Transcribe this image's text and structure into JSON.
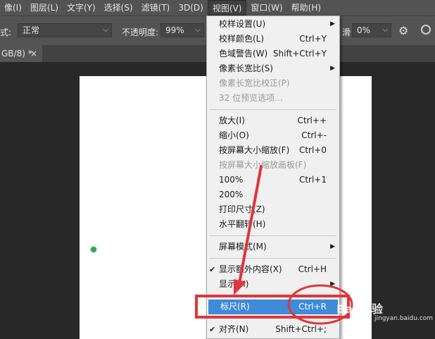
{
  "menubar": {
    "items": [
      "像(I)",
      "图层(L)",
      "文字(Y)",
      "选择(S)",
      "滤镜(T)",
      "3D(D)",
      "视图(V)",
      "窗口(W)",
      "帮助(H)"
    ],
    "active_index": 6
  },
  "options": {
    "mode_label": "式:",
    "mode_value": "正常",
    "opacity_label": "不透明度:",
    "opacity_value": "99%",
    "right_label": "滑",
    "right_value": "0%"
  },
  "tab": {
    "title": "GB/8) *",
    "close": "×"
  },
  "view_menu": {
    "items": [
      {
        "label": "校样设置(U)",
        "submenu": true
      },
      {
        "label": "校样颜色(L)",
        "shortcut": "Ctrl+Y"
      },
      {
        "label": "色域警告(W)",
        "shortcut": "Shift+Ctrl+Y"
      },
      {
        "label": "像素长宽比(S)",
        "submenu": true
      },
      {
        "label": "像素长宽比校正(P)",
        "disabled": true
      },
      {
        "label": "32 位预览选项...",
        "disabled": true
      },
      {
        "label": "放大(I)",
        "shortcut": "Ctrl++"
      },
      {
        "label": "缩小(O)",
        "shortcut": "Ctrl+-"
      },
      {
        "label": "按屏幕大小缩放(F)",
        "shortcut": "Ctrl+0"
      },
      {
        "label": "按屏幕大小缩放画板(F)",
        "disabled": true
      },
      {
        "label": "100%",
        "shortcut": "Ctrl+1"
      },
      {
        "label": "200%"
      },
      {
        "label": "打印尺寸(Z)"
      },
      {
        "label": "水平翻转(H)"
      },
      {
        "label": "屏幕模式(M)",
        "submenu": true
      },
      {
        "label": "显示额外内容(X)",
        "shortcut": "Ctrl+H",
        "checked": true
      },
      {
        "label": "显示(H)",
        "submenu": true
      },
      {
        "label": "标尺(R)",
        "shortcut": "Ctrl+R",
        "highlighted": true
      },
      {
        "label": "对齐(N)",
        "shortcut": "Shift+Ctrl+;",
        "checked": true
      }
    ]
  },
  "colors": {
    "highlight": "#3f8ad9",
    "annotation": "#e0353a",
    "menubar": "#535353"
  },
  "watermark": {
    "brand": "Bai 经验",
    "site": "jingyan.baidu.com"
  }
}
